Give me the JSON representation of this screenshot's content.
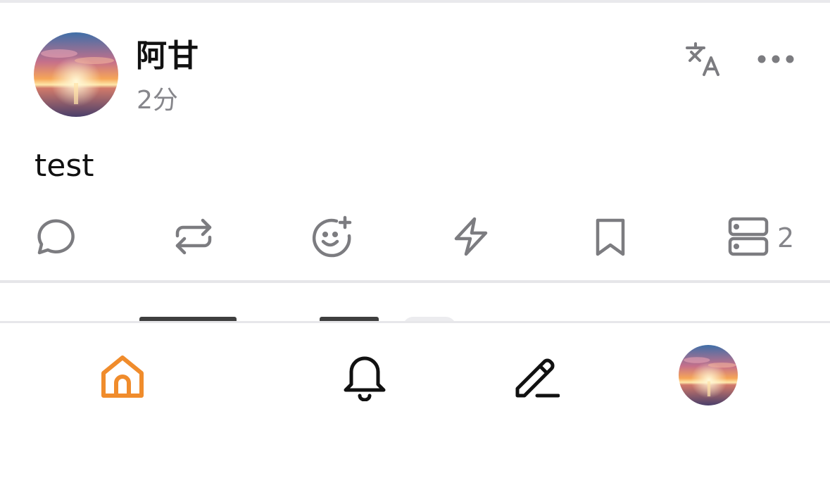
{
  "post": {
    "author_name": "阿甘",
    "time": "2分",
    "body": "test",
    "actions": {
      "server_count": "2"
    },
    "icons": {
      "translate": "translate-icon",
      "more": "more-horizontal-icon",
      "reply": "reply-bubble-icon",
      "repost": "repost-icon",
      "react": "add-reaction-icon",
      "boost": "lightning-icon",
      "bookmark": "bookmark-icon",
      "server": "server-icon"
    }
  },
  "nav": {
    "items": [
      "home-icon",
      "bell-icon",
      "pencil-icon",
      "avatar"
    ],
    "active": "home",
    "active_color": "#f08c2c"
  },
  "colors": {
    "icon_gray": "#7c7c80",
    "text": "#111111",
    "muted": "#86868b"
  }
}
